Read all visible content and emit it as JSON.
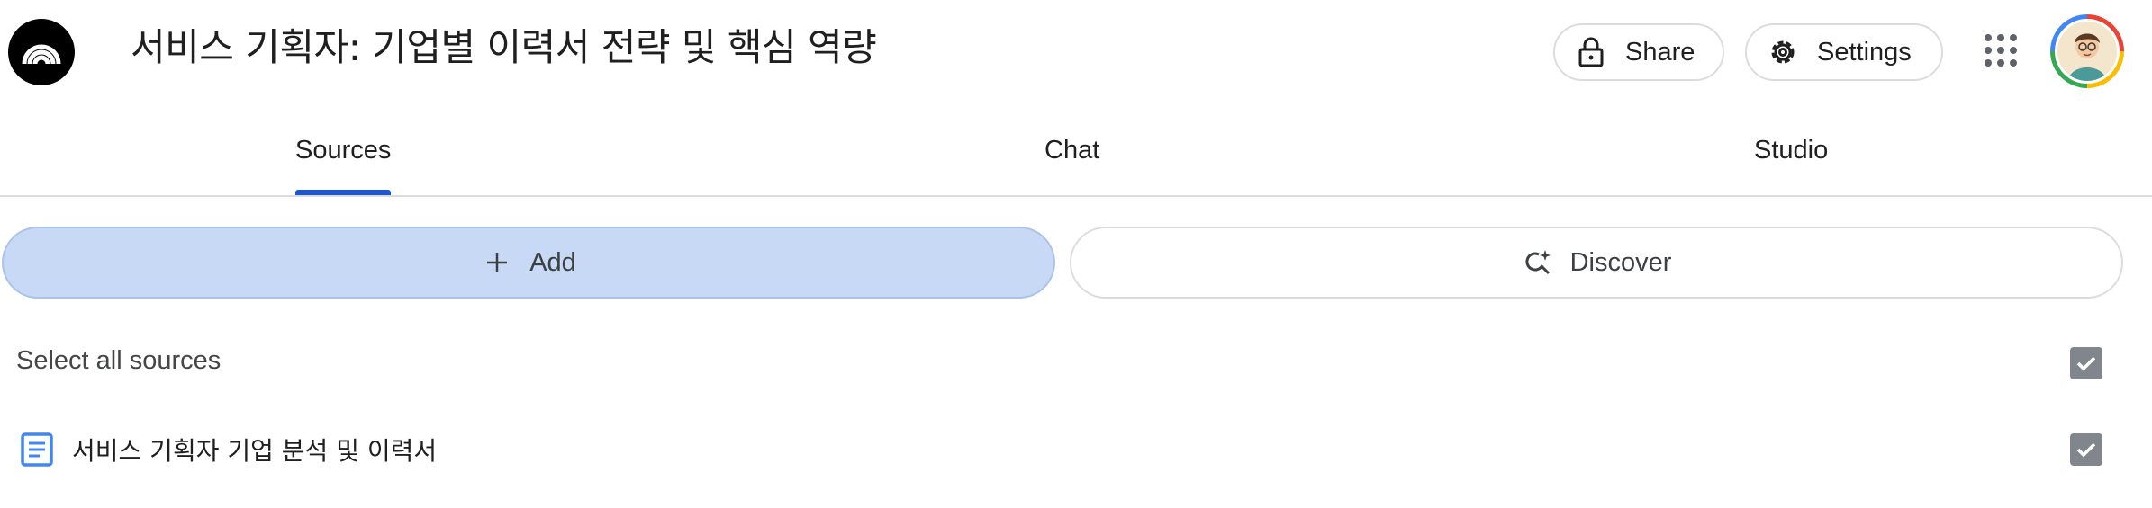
{
  "header": {
    "title": "서비스 기획자: 기업별 이력서 전략 및 핵심 역량",
    "share_label": "Share",
    "settings_label": "Settings"
  },
  "tabs": [
    {
      "label": "Sources",
      "active": true
    },
    {
      "label": "Chat",
      "active": false
    },
    {
      "label": "Studio",
      "active": false
    }
  ],
  "actions": {
    "add_label": "Add",
    "discover_label": "Discover"
  },
  "sources": {
    "select_all_label": "Select all sources",
    "select_all_checked": true,
    "items": [
      {
        "title": "서비스 기획자 기업 분석 및 이력서",
        "icon": "document-icon",
        "checked": true
      }
    ]
  },
  "colors": {
    "accent": "#1a56d6",
    "add_button_bg": "#c7d9f5",
    "checkbox": "#80868b",
    "source_icon": "#4285f4"
  }
}
